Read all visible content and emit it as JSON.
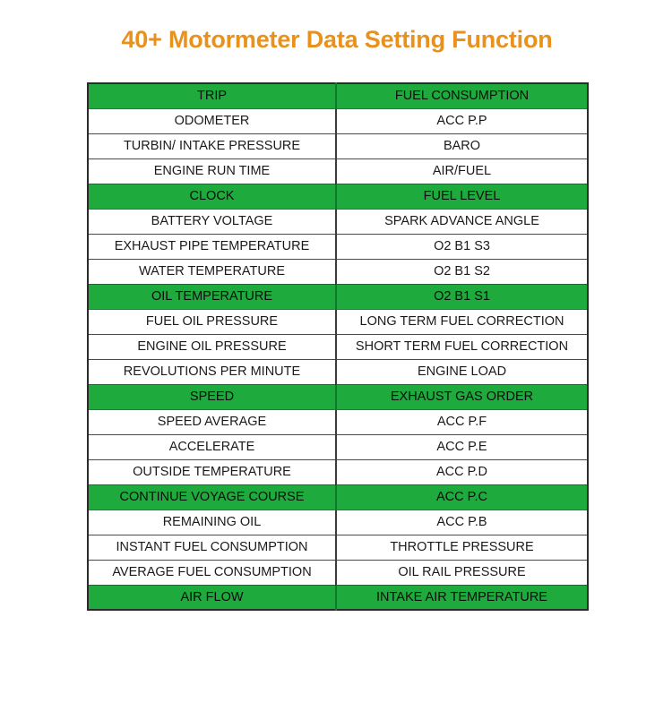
{
  "page": {
    "title": "40+ Motormeter Data Setting Function",
    "background_color": "#ffffff",
    "title_color": "#e8911c"
  },
  "table": {
    "accent_color": "#1faa3d",
    "text_color": "#1a1a1a",
    "border_color": "#2b2b2b",
    "column_count": 2,
    "row_count": 21,
    "highlighted_row_indices": [
      0,
      4,
      8,
      12,
      16,
      20
    ],
    "rows": [
      {
        "highlight": true,
        "left": "TRIP",
        "right": "FUEL CONSUMPTION"
      },
      {
        "highlight": false,
        "left": "ODOMETER",
        "right": "ACC P.P"
      },
      {
        "highlight": false,
        "left": "TURBIN/ INTAKE PRESSURE",
        "right": "BARO"
      },
      {
        "highlight": false,
        "left": "ENGINE RUN TIME",
        "right": "AIR/FUEL"
      },
      {
        "highlight": true,
        "left": "CLOCK",
        "right": "FUEL LEVEL"
      },
      {
        "highlight": false,
        "left": "BATTERY VOLTAGE",
        "right": "SPARK ADVANCE ANGLE"
      },
      {
        "highlight": false,
        "left": "EXHAUST PIPE TEMPERATURE",
        "right": "O2 B1 S3"
      },
      {
        "highlight": false,
        "left": "WATER TEMPERATURE",
        "right": "O2 B1 S2"
      },
      {
        "highlight": true,
        "left": "OIL TEMPERATURE",
        "right": "O2 B1 S1"
      },
      {
        "highlight": false,
        "left": "FUEL OIL PRESSURE",
        "right": "LONG TERM FUEL CORRECTION"
      },
      {
        "highlight": false,
        "left": "ENGINE OIL PRESSURE",
        "right": "SHORT TERM FUEL CORRECTION"
      },
      {
        "highlight": false,
        "left": "REVOLUTIONS PER MINUTE",
        "right": "ENGINE LOAD"
      },
      {
        "highlight": true,
        "left": "SPEED",
        "right": "EXHAUST GAS ORDER"
      },
      {
        "highlight": false,
        "left": "SPEED AVERAGE",
        "right": "ACC P.F"
      },
      {
        "highlight": false,
        "left": "ACCELERATE",
        "right": "ACC P.E"
      },
      {
        "highlight": false,
        "left": "OUTSIDE TEMPERATURE",
        "right": "ACC P.D"
      },
      {
        "highlight": true,
        "left": "CONTINUE VOYAGE COURSE",
        "right": "ACC P.C"
      },
      {
        "highlight": false,
        "left": "REMAINING OIL",
        "right": "ACC P.B"
      },
      {
        "highlight": false,
        "left": "INSTANT FUEL CONSUMPTION",
        "right": "THROTTLE PRESSURE"
      },
      {
        "highlight": false,
        "left": "AVERAGE FUEL CONSUMPTION",
        "right": "OIL RAIL PRESSURE"
      },
      {
        "highlight": true,
        "left": "AIR FLOW",
        "right": "INTAKE AIR TEMPERATURE"
      }
    ]
  }
}
